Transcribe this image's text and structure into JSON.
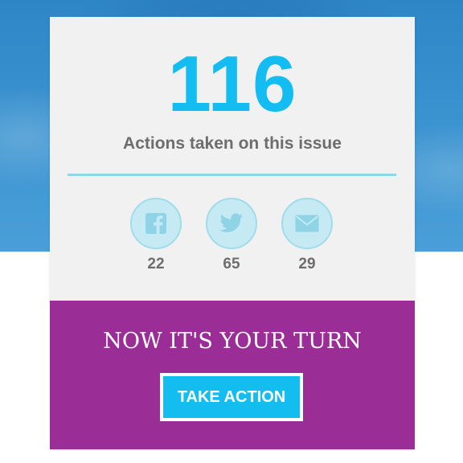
{
  "stats": {
    "count": "116",
    "caption": "Actions taken on this issue"
  },
  "share": [
    {
      "network": "Facebook",
      "icon": "facebook-icon",
      "count": "22"
    },
    {
      "network": "Twitter",
      "icon": "twitter-icon",
      "count": "65"
    },
    {
      "network": "Email",
      "icon": "email-icon",
      "count": "29"
    }
  ],
  "cta": {
    "title": "NOW IT'S YOUR TURN",
    "button_label": "TAKE ACTION"
  },
  "colors": {
    "accent": "#13bdf1",
    "purple": "#9b2d96",
    "card_bg": "#f1f1f1",
    "hero_blue": "#3a92cf",
    "icon_fill": "#c6eaf3",
    "text_gray": "#6d6d6d"
  }
}
